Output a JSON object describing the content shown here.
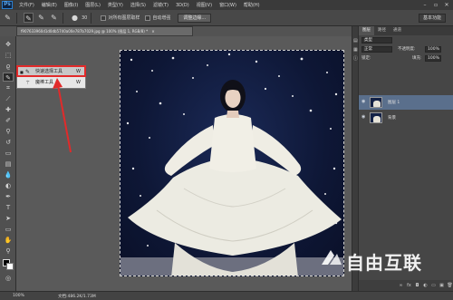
{
  "app": {
    "logo_text": "Ps",
    "menus": [
      "文件(F)",
      "编辑(E)",
      "图像(I)",
      "图层(L)",
      "类型(Y)",
      "选择(S)",
      "滤镜(T)",
      "3D(D)",
      "视图(V)",
      "窗口(W)",
      "帮助(H)"
    ],
    "window_controls": [
      "minimize-icon",
      "maximize-icon",
      "close-icon"
    ]
  },
  "options_bar": {
    "brush_size": "30",
    "sample_all_layers": "对所有图层取样",
    "auto_enhance": "自动增强",
    "refine_edge": "调整边缘...",
    "workspace": "基本功能"
  },
  "document": {
    "tab_title": "f907633960d1d0db5740a00e787b7029.jpg @ 100% (图层 1, RGB/8) *",
    "tab_close": "×"
  },
  "tool_flyout": {
    "items": [
      {
        "label": "快速选择工具",
        "shortcut": "W",
        "icon": "quick-selection-icon",
        "active": true
      },
      {
        "label": "魔棒工具",
        "shortcut": "W",
        "icon": "magic-wand-icon",
        "active": false
      }
    ],
    "highlight_color": "#e22a2a"
  },
  "layers_panel": {
    "tabs": [
      "图层",
      "路径",
      "通道"
    ],
    "kind_label": "类型",
    "blend_mode": "正常",
    "opacity_label": "不透明度:",
    "opacity_value": "100%",
    "lock_label": "锁定:",
    "fill_label": "填充:",
    "fill_value": "100%",
    "layers": [
      {
        "name": "图层 1",
        "selected": true
      },
      {
        "name": "背景",
        "selected": false
      }
    ]
  },
  "status_bar": {
    "zoom": "100%",
    "doc_info": "文档:486.2K/1.73M"
  },
  "watermark": {
    "text": "自由互联"
  },
  "colors": {
    "accent_red": "#e22a2a",
    "selected_layer": "#5a6f8c",
    "photo_background": "#0e1736"
  }
}
